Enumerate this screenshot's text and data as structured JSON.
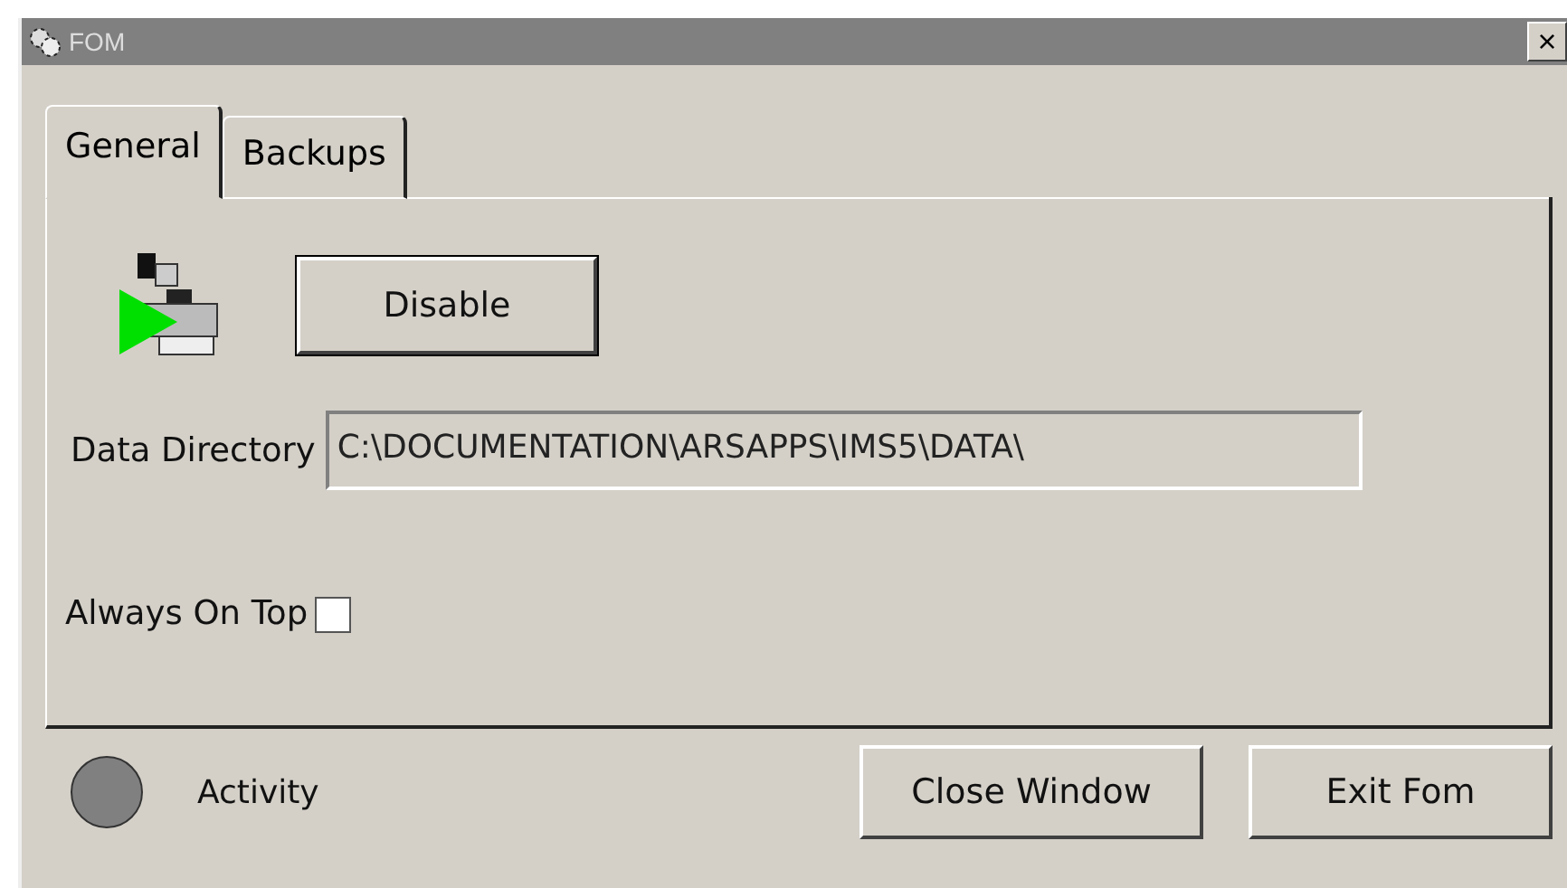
{
  "window": {
    "title": "FOM",
    "close_label": "×"
  },
  "tabs": [
    {
      "label": "General",
      "selected": true
    },
    {
      "label": "Backups",
      "selected": false
    }
  ],
  "service": {
    "running": true,
    "button": "Disable"
  },
  "data_directory": {
    "label": "Data Directory",
    "value": "C:\\DOCUMENTATION\\ARSAPPS\\IMS5\\DATA\\"
  },
  "always_on_top": {
    "label": "Always On Top",
    "checked": false
  },
  "activity": {
    "label": "Activity",
    "active": false
  },
  "buttons": [
    "Close Window",
    "Exit Fom"
  ]
}
